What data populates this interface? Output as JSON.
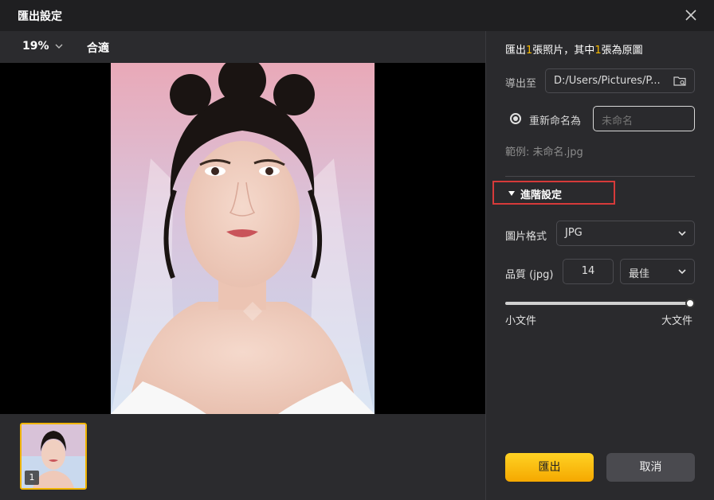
{
  "window": {
    "title": "匯出設定"
  },
  "toolbar": {
    "zoom": "19%",
    "fit_label": "合適"
  },
  "thumbnail": {
    "index": "1"
  },
  "summary": {
    "p1": "匯出",
    "n1": "1",
    "p2": "張照片，其中",
    "n2": "1",
    "p3": "張為原圖"
  },
  "export_to": {
    "label": "導出至",
    "path": "D:/Users/Pictures/P..."
  },
  "rename": {
    "label": "重新命名為",
    "placeholder": "未命名",
    "example": "範例: 未命名.jpg"
  },
  "advanced": {
    "label": "進階設定"
  },
  "format": {
    "label": "圖片格式",
    "value": "JPG"
  },
  "quality": {
    "label": "品質 (jpg)",
    "value": "14",
    "preset": "最佳",
    "level": 1.0,
    "min_label": "小文件",
    "max_label": "大文件"
  },
  "buttons": {
    "export": "匯出",
    "cancel": "取消"
  },
  "colors": {
    "accent": "#f5b800",
    "highlight_box": "#d63a3a"
  }
}
